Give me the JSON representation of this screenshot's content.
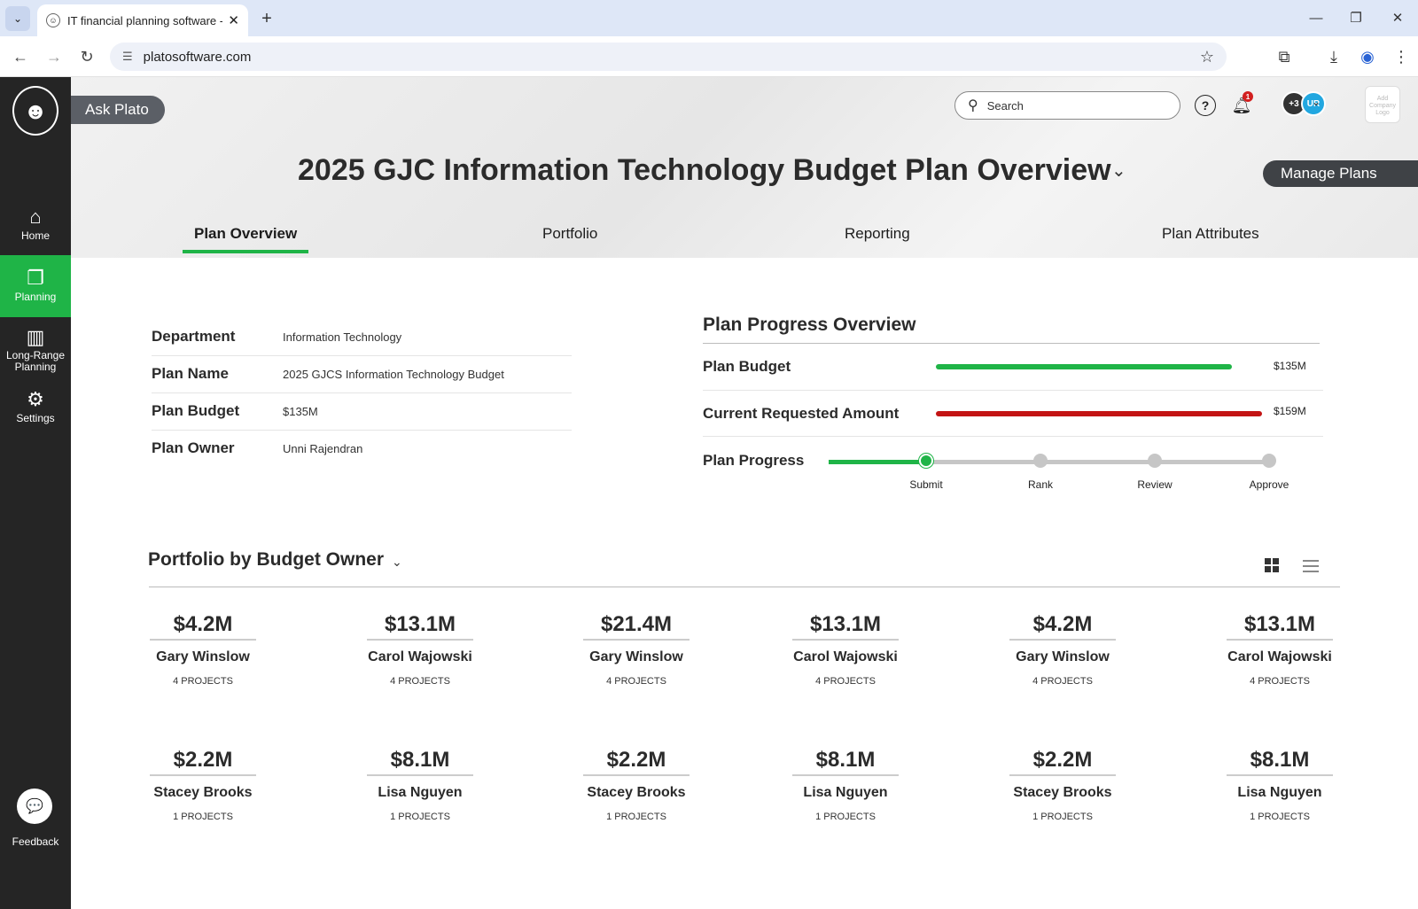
{
  "browser": {
    "tab_title": "IT financial planning software -",
    "url": "platosoftware.com",
    "window_controls": [
      "minimize-icon",
      "restore-icon",
      "close-icon"
    ]
  },
  "app": {
    "ask_plato": "Ask Plato",
    "search_placeholder": "Search",
    "notification_count": "1",
    "avatars": {
      "more": "+3",
      "user": "UR"
    },
    "company_logo": "Add Company Logo",
    "title": "2025 GJC Information Technology Budget Plan Overview",
    "manage_plans": "Manage Plans",
    "accent_color": "#1fb447"
  },
  "sidebar": {
    "items": [
      {
        "label": "Home",
        "icon": "home-icon"
      },
      {
        "label": "Planning",
        "icon": "planning-icon",
        "active": true
      },
      {
        "label": "Long-Range Planning",
        "icon": "map-icon"
      },
      {
        "label": "Settings",
        "icon": "gear-icon"
      }
    ],
    "feedback": "Feedback"
  },
  "tabs": [
    {
      "label": "Plan Overview",
      "active": true
    },
    {
      "label": "Portfolio"
    },
    {
      "label": "Reporting"
    },
    {
      "label": "Plan Attributes"
    }
  ],
  "plan_info": [
    {
      "key": "Department",
      "value": "Information Technology"
    },
    {
      "key": "Plan Name",
      "value": "2025 GJCS Information Technology Budget"
    },
    {
      "key": "Plan Budget",
      "value": "$135M"
    },
    {
      "key": "Plan Owner",
      "value": "Unni Rajendran"
    }
  ],
  "progress": {
    "title": "Plan Progress Overview",
    "budget_label": "Plan Budget",
    "budget_value": "$135M",
    "requested_label": "Current Requested Amount",
    "requested_value": "$159M",
    "progress_label": "Plan Progress",
    "steps": [
      "Submit",
      "Rank",
      "Review",
      "Approve"
    ],
    "current_step": 1
  },
  "portfolio": {
    "title": "Portfolio by Budget Owner",
    "cards": [
      {
        "amount": "$4.2M",
        "owner": "Gary Winslow",
        "projects": "4 PROJECTS"
      },
      {
        "amount": "$13.1M",
        "owner": "Carol Wajowski",
        "projects": "4 PROJECTS"
      },
      {
        "amount": "$21.4M",
        "owner": "Gary Winslow",
        "projects": "4 PROJECTS"
      },
      {
        "amount": "$13.1M",
        "owner": "Carol Wajowski",
        "projects": "4 PROJECTS"
      },
      {
        "amount": "$4.2M",
        "owner": "Gary Winslow",
        "projects": "4 PROJECTS"
      },
      {
        "amount": "$13.1M",
        "owner": "Carol Wajowski",
        "projects": "4 PROJECTS"
      },
      {
        "amount": "$2.2M",
        "owner": "Stacey Brooks",
        "projects": "1 PROJECTS"
      },
      {
        "amount": "$8.1M",
        "owner": "Lisa Nguyen",
        "projects": "1 PROJECTS"
      },
      {
        "amount": "$2.2M",
        "owner": "Stacey Brooks",
        "projects": "1 PROJECTS"
      },
      {
        "amount": "$8.1M",
        "owner": "Lisa Nguyen",
        "projects": "1 PROJECTS"
      },
      {
        "amount": "$2.2M",
        "owner": "Stacey Brooks",
        "projects": "1 PROJECTS"
      },
      {
        "amount": "$8.1M",
        "owner": "Lisa Nguyen",
        "projects": "1 PROJECTS"
      }
    ]
  }
}
